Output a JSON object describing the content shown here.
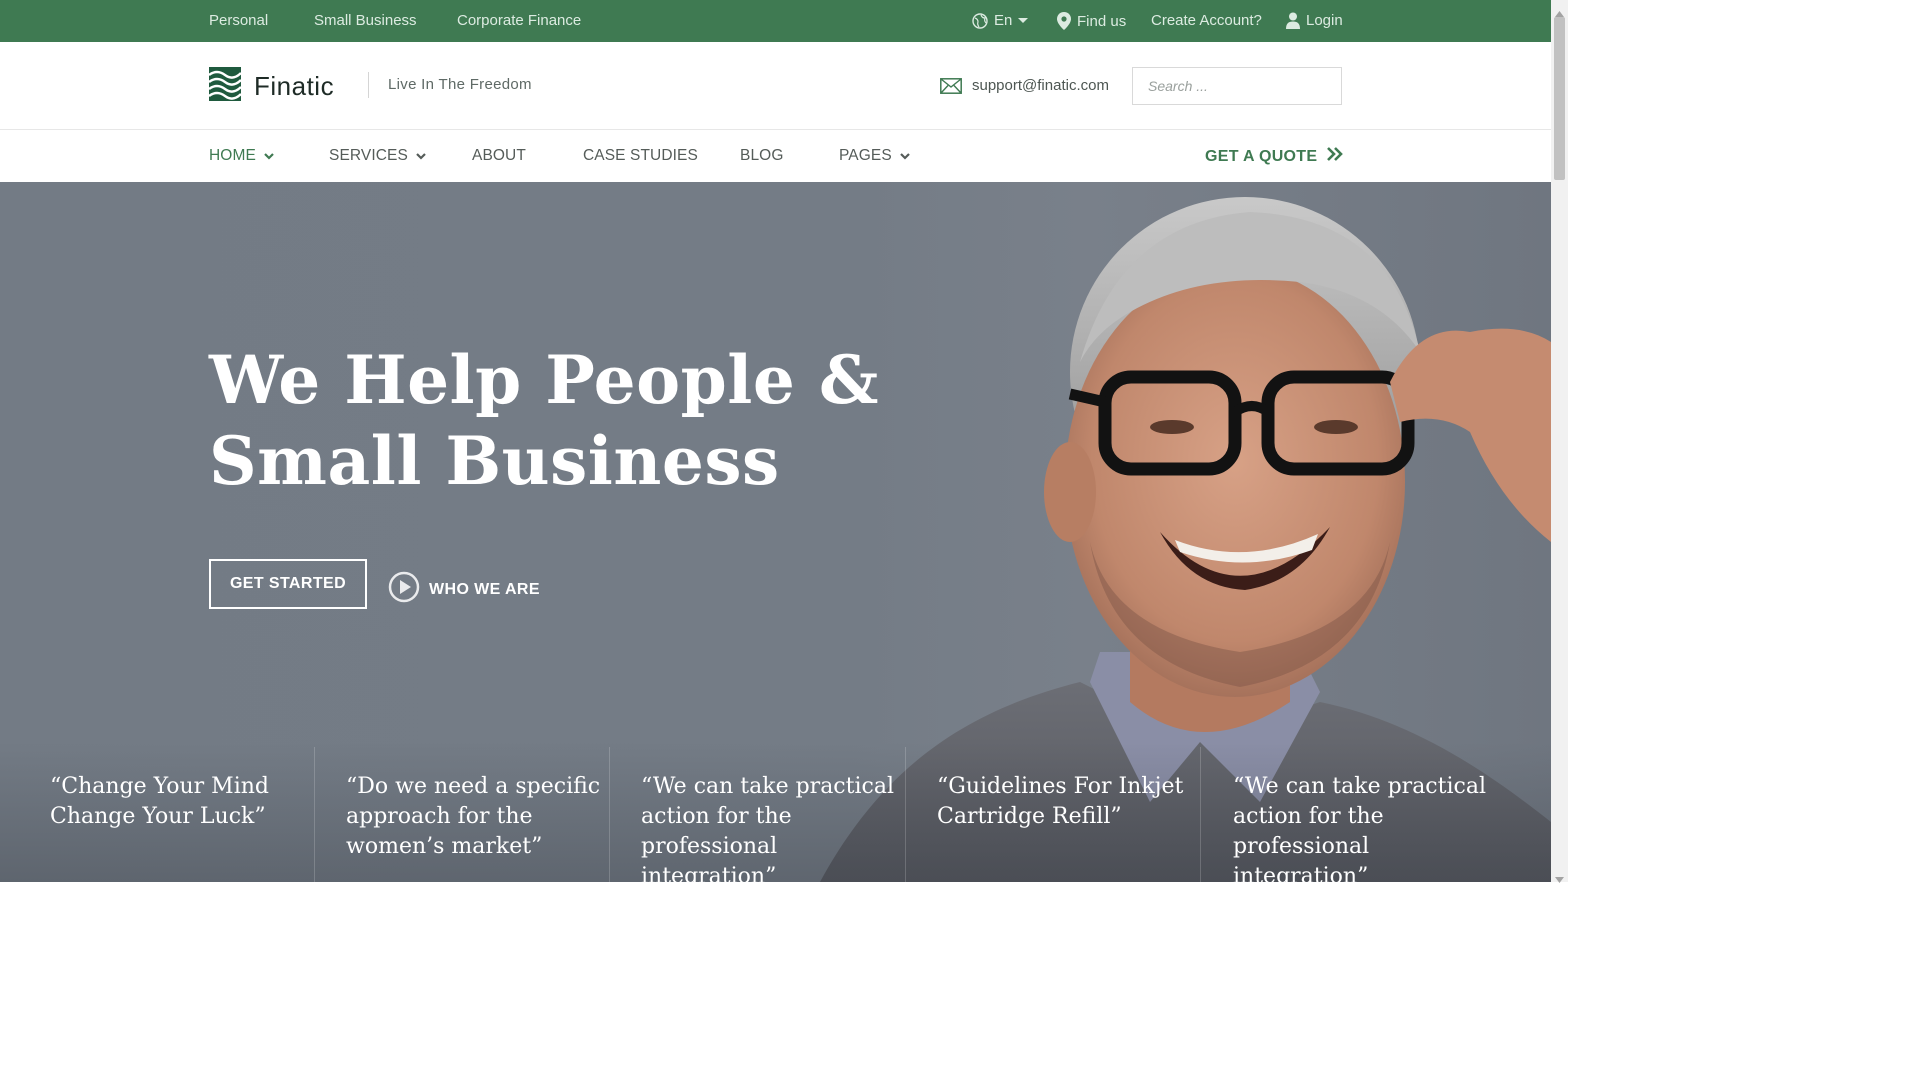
{
  "topbar": {
    "links": [
      "Personal",
      "Small Business",
      "Corporate Finance"
    ],
    "language": "En",
    "find_us": "Find us",
    "create_account": "Create Account?",
    "login": "Login"
  },
  "header": {
    "brand": "Finatic",
    "tagline": "Live In The Freedom",
    "email": "support@finatic.com",
    "search_placeholder": "Search ..."
  },
  "nav": {
    "items": [
      {
        "label": "HOME",
        "has_dropdown": true,
        "active": true
      },
      {
        "label": "SERVICES",
        "has_dropdown": true
      },
      {
        "label": "ABOUT"
      },
      {
        "label": "CASE STUDIES"
      },
      {
        "label": "BLOG"
      },
      {
        "label": "PAGES",
        "has_dropdown": true
      }
    ],
    "cta": "GET A QUOTE"
  },
  "hero": {
    "title_line1": "We Help People &",
    "title_line2": "Small Business",
    "primary_button": "GET STARTED",
    "secondary_link": "WHO WE ARE"
  },
  "quotes": [
    {
      "line1": "“Change Your Mind",
      "line2": "Change Your Luck”"
    },
    {
      "line1": "“Do we need a specific",
      "line2": "approach for the",
      "line3": "women’s market”"
    },
    {
      "line1": "“We can take practical",
      "line2": "action for the",
      "line3": "professional",
      "line4": "integration”"
    },
    {
      "line1": "“Guidelines For Inkjet",
      "line2": "Cartridge Refill”"
    },
    {
      "line1": "“We can take practical",
      "line2": "action for the",
      "line3": "professional",
      "line4": "integration”"
    }
  ],
  "colors": {
    "brand_green": "#3f7a52",
    "hero_gray": "#747c86",
    "text_dark": "#1e2b26"
  }
}
